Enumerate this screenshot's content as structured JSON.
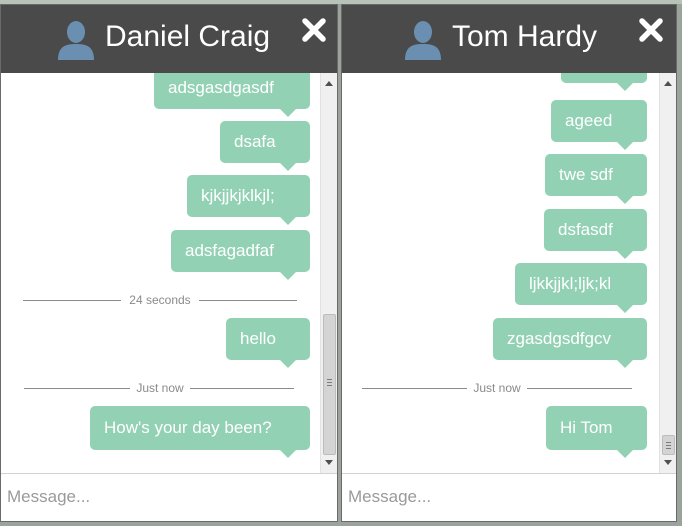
{
  "chat_left": {
    "title": "Daniel Craig",
    "messages": [
      "adsgasdgasdf",
      "dsafa",
      "kjkjjkjklkjl;",
      "adsfagadfaf",
      "hello",
      "How's your day been?"
    ],
    "separators": [
      "24 seconds",
      "Just now"
    ],
    "input_placeholder": "Message..."
  },
  "chat_right": {
    "title": "Tom Hardy",
    "messages": [
      "",
      "ageed",
      "twe sdf",
      "dsfasdf",
      "ljkkjjkl;ljk;kl",
      "zgasdgsdfgcv",
      "Hi Tom"
    ],
    "separators": [
      "Just now"
    ],
    "input_placeholder": "Message..."
  },
  "colors": {
    "header_bg": "#4a4a4a",
    "bubble": "#93d1b5",
    "avatar": "#6a8fb0"
  },
  "icons": {
    "avatar": "user-silhouette",
    "close": "cross"
  }
}
